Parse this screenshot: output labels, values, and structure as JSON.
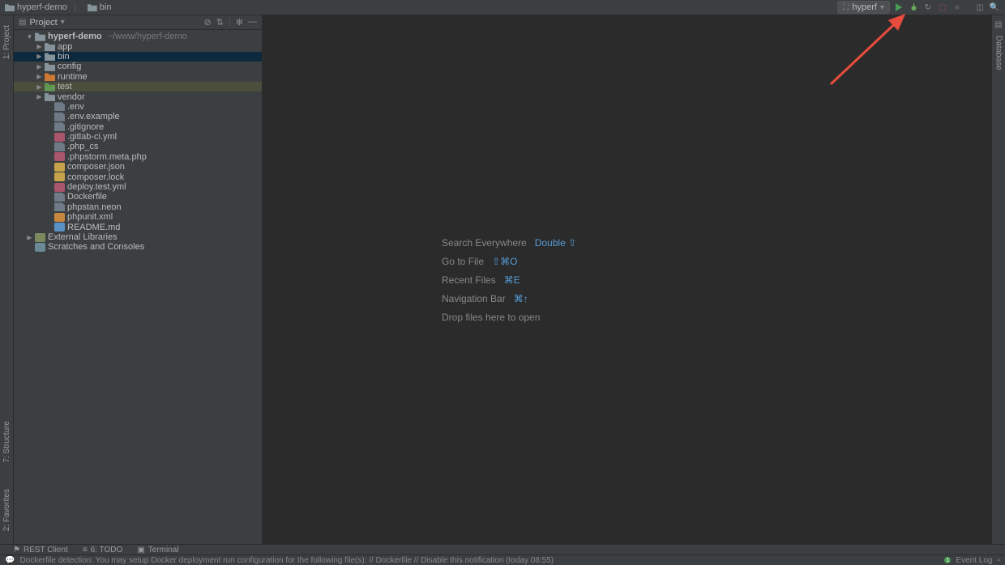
{
  "breadcrumb": [
    {
      "icon": "folder",
      "label": "hyperf-demo"
    },
    {
      "icon": "folder",
      "label": "bin"
    }
  ],
  "runConfig": {
    "name": "hyperf"
  },
  "projectPanel": {
    "title": "Project",
    "tree": [
      {
        "depth": 0,
        "arrow": "open",
        "icon": "folder",
        "label": "hyperf-demo",
        "path": "~/www/hyperf-demo",
        "bold": true
      },
      {
        "depth": 1,
        "arrow": "closed",
        "icon": "folder",
        "label": "app"
      },
      {
        "depth": 1,
        "arrow": "closed",
        "icon": "folder",
        "label": "bin",
        "selected": true
      },
      {
        "depth": 1,
        "arrow": "closed",
        "icon": "folder",
        "label": "config"
      },
      {
        "depth": 1,
        "arrow": "closed",
        "icon": "folder-red",
        "label": "runtime"
      },
      {
        "depth": 1,
        "arrow": "closed",
        "icon": "folder-green",
        "label": "test",
        "highlighted": true
      },
      {
        "depth": 1,
        "arrow": "closed",
        "icon": "folder",
        "label": "vendor"
      },
      {
        "depth": 2,
        "arrow": "none",
        "icon": "file",
        "label": ".env"
      },
      {
        "depth": 2,
        "arrow": "none",
        "icon": "file",
        "label": ".env.example"
      },
      {
        "depth": 2,
        "arrow": "none",
        "icon": "file",
        "label": ".gitignore"
      },
      {
        "depth": 2,
        "arrow": "none",
        "icon": "yml",
        "label": ".gitlab-ci.yml"
      },
      {
        "depth": 2,
        "arrow": "none",
        "icon": "file",
        "label": ".php_cs"
      },
      {
        "depth": 2,
        "arrow": "none",
        "icon": "yml",
        "label": ".phpstorm.meta.php"
      },
      {
        "depth": 2,
        "arrow": "none",
        "icon": "json",
        "label": "composer.json"
      },
      {
        "depth": 2,
        "arrow": "none",
        "icon": "json",
        "label": "composer.lock"
      },
      {
        "depth": 2,
        "arrow": "none",
        "icon": "yml",
        "label": "deploy.test.yml"
      },
      {
        "depth": 2,
        "arrow": "none",
        "icon": "file",
        "label": "Dockerfile"
      },
      {
        "depth": 2,
        "arrow": "none",
        "icon": "file",
        "label": "phpstan.neon"
      },
      {
        "depth": 2,
        "arrow": "none",
        "icon": "xml",
        "label": "phpunit.xml"
      },
      {
        "depth": 2,
        "arrow": "none",
        "icon": "md",
        "label": "README.md"
      },
      {
        "depth": 0,
        "arrow": "closed",
        "icon": "lib",
        "label": "External Libraries"
      },
      {
        "depth": 0,
        "arrow": "none",
        "icon": "scratch",
        "label": "Scratches and Consoles"
      }
    ]
  },
  "editorShortcuts": [
    {
      "label": "Search Everywhere",
      "key": "Double ⇧",
      "link": true
    },
    {
      "label": "Go to File",
      "key": "⇧⌘O"
    },
    {
      "label": "Recent Files",
      "key": "⌘E"
    },
    {
      "label": "Navigation Bar",
      "key": "⌘↑"
    },
    {
      "label": "Drop files here to open",
      "key": ""
    }
  ],
  "leftGutter": {
    "top": "1: Project",
    "bottom": [
      "7: Structure",
      "2: Favorites"
    ]
  },
  "rightGutter": {
    "label": "Database"
  },
  "bottomTools": [
    {
      "icon": "rest",
      "label": "REST Client"
    },
    {
      "icon": "todo",
      "label": "6: TODO"
    },
    {
      "icon": "terminal",
      "label": "Terminal"
    }
  ],
  "statusBar": {
    "message": "Dockerfile detection: You may setup Docker deployment run configuration for the following file(s): // Dockerfile // Disable this notification (today 08:55)",
    "eventLog": "Event Log"
  },
  "colors": {
    "background": "#3c3f41",
    "editor": "#2b2b2b",
    "selection": "#0d293e",
    "link": "#569cd6",
    "green": "#499c54"
  }
}
